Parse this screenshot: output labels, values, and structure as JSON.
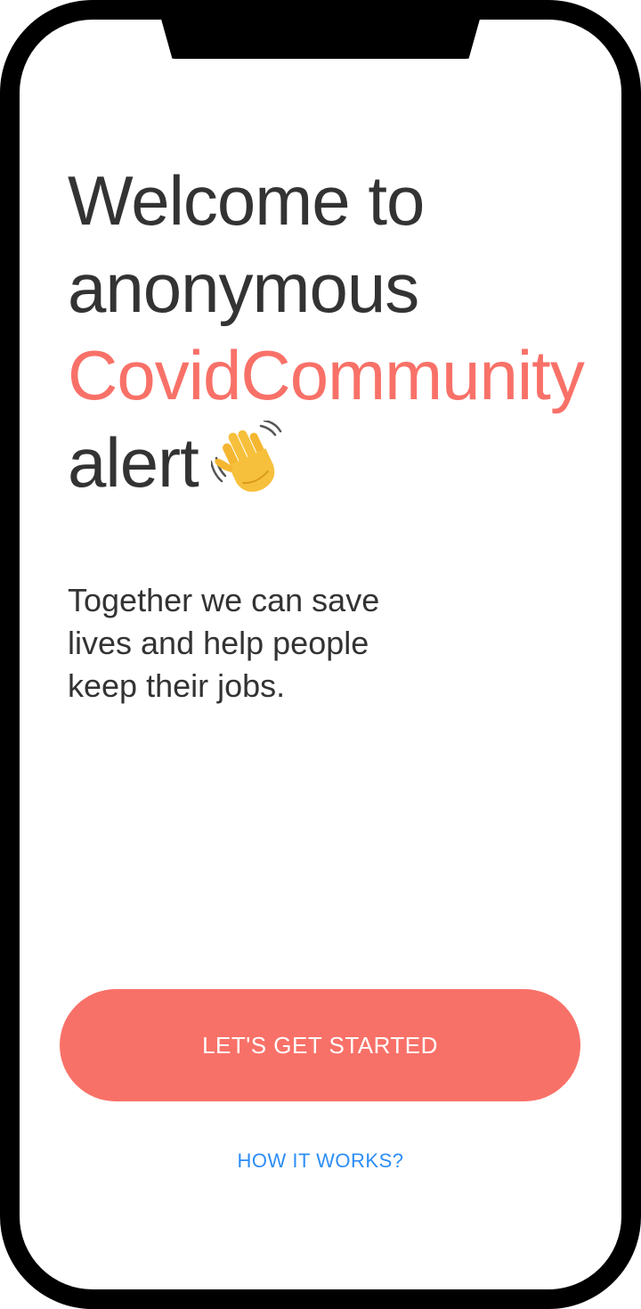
{
  "welcome": {
    "line1": "Welcome to",
    "line2": "anonymous",
    "brand": "CovidCommunity",
    "line4": "alert",
    "wave_icon": "waving-hand-icon"
  },
  "subtitle": "Together we can save lives and help people keep their jobs.",
  "actions": {
    "primary_label": "LET'S GET STARTED",
    "secondary_label": "HOW IT WORKS?"
  },
  "colors": {
    "accent": "#f87168",
    "link": "#2d8df5",
    "text": "#333333",
    "frame": "#000000"
  }
}
